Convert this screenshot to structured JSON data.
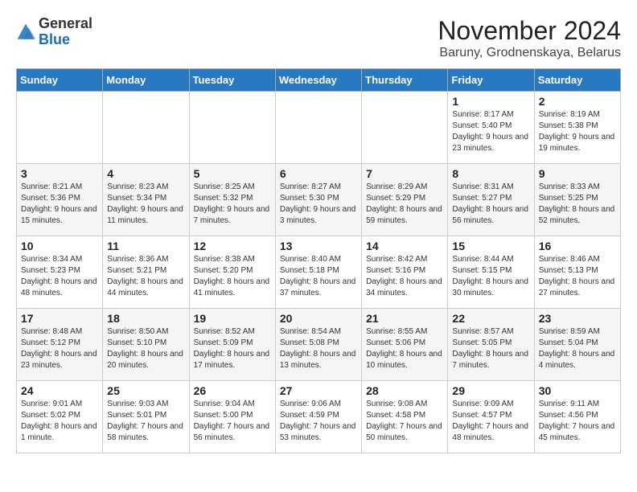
{
  "logo": {
    "general": "General",
    "blue": "Blue"
  },
  "header": {
    "title": "November 2024",
    "subtitle": "Baruny, Grodnenskaya, Belarus"
  },
  "days_of_week": [
    "Sunday",
    "Monday",
    "Tuesday",
    "Wednesday",
    "Thursday",
    "Friday",
    "Saturday"
  ],
  "weeks": [
    [
      {
        "day": "",
        "info": ""
      },
      {
        "day": "",
        "info": ""
      },
      {
        "day": "",
        "info": ""
      },
      {
        "day": "",
        "info": ""
      },
      {
        "day": "",
        "info": ""
      },
      {
        "day": "1",
        "info": "Sunrise: 8:17 AM\nSunset: 5:40 PM\nDaylight: 9 hours and 23 minutes."
      },
      {
        "day": "2",
        "info": "Sunrise: 8:19 AM\nSunset: 5:38 PM\nDaylight: 9 hours and 19 minutes."
      }
    ],
    [
      {
        "day": "3",
        "info": "Sunrise: 8:21 AM\nSunset: 5:36 PM\nDaylight: 9 hours and 15 minutes."
      },
      {
        "day": "4",
        "info": "Sunrise: 8:23 AM\nSunset: 5:34 PM\nDaylight: 9 hours and 11 minutes."
      },
      {
        "day": "5",
        "info": "Sunrise: 8:25 AM\nSunset: 5:32 PM\nDaylight: 9 hours and 7 minutes."
      },
      {
        "day": "6",
        "info": "Sunrise: 8:27 AM\nSunset: 5:30 PM\nDaylight: 9 hours and 3 minutes."
      },
      {
        "day": "7",
        "info": "Sunrise: 8:29 AM\nSunset: 5:29 PM\nDaylight: 8 hours and 59 minutes."
      },
      {
        "day": "8",
        "info": "Sunrise: 8:31 AM\nSunset: 5:27 PM\nDaylight: 8 hours and 56 minutes."
      },
      {
        "day": "9",
        "info": "Sunrise: 8:33 AM\nSunset: 5:25 PM\nDaylight: 8 hours and 52 minutes."
      }
    ],
    [
      {
        "day": "10",
        "info": "Sunrise: 8:34 AM\nSunset: 5:23 PM\nDaylight: 8 hours and 48 minutes."
      },
      {
        "day": "11",
        "info": "Sunrise: 8:36 AM\nSunset: 5:21 PM\nDaylight: 8 hours and 44 minutes."
      },
      {
        "day": "12",
        "info": "Sunrise: 8:38 AM\nSunset: 5:20 PM\nDaylight: 8 hours and 41 minutes."
      },
      {
        "day": "13",
        "info": "Sunrise: 8:40 AM\nSunset: 5:18 PM\nDaylight: 8 hours and 37 minutes."
      },
      {
        "day": "14",
        "info": "Sunrise: 8:42 AM\nSunset: 5:16 PM\nDaylight: 8 hours and 34 minutes."
      },
      {
        "day": "15",
        "info": "Sunrise: 8:44 AM\nSunset: 5:15 PM\nDaylight: 8 hours and 30 minutes."
      },
      {
        "day": "16",
        "info": "Sunrise: 8:46 AM\nSunset: 5:13 PM\nDaylight: 8 hours and 27 minutes."
      }
    ],
    [
      {
        "day": "17",
        "info": "Sunrise: 8:48 AM\nSunset: 5:12 PM\nDaylight: 8 hours and 23 minutes."
      },
      {
        "day": "18",
        "info": "Sunrise: 8:50 AM\nSunset: 5:10 PM\nDaylight: 8 hours and 20 minutes."
      },
      {
        "day": "19",
        "info": "Sunrise: 8:52 AM\nSunset: 5:09 PM\nDaylight: 8 hours and 17 minutes."
      },
      {
        "day": "20",
        "info": "Sunrise: 8:54 AM\nSunset: 5:08 PM\nDaylight: 8 hours and 13 minutes."
      },
      {
        "day": "21",
        "info": "Sunrise: 8:55 AM\nSunset: 5:06 PM\nDaylight: 8 hours and 10 minutes."
      },
      {
        "day": "22",
        "info": "Sunrise: 8:57 AM\nSunset: 5:05 PM\nDaylight: 8 hours and 7 minutes."
      },
      {
        "day": "23",
        "info": "Sunrise: 8:59 AM\nSunset: 5:04 PM\nDaylight: 8 hours and 4 minutes."
      }
    ],
    [
      {
        "day": "24",
        "info": "Sunrise: 9:01 AM\nSunset: 5:02 PM\nDaylight: 8 hours and 1 minute."
      },
      {
        "day": "25",
        "info": "Sunrise: 9:03 AM\nSunset: 5:01 PM\nDaylight: 7 hours and 58 minutes."
      },
      {
        "day": "26",
        "info": "Sunrise: 9:04 AM\nSunset: 5:00 PM\nDaylight: 7 hours and 56 minutes."
      },
      {
        "day": "27",
        "info": "Sunrise: 9:06 AM\nSunset: 4:59 PM\nDaylight: 7 hours and 53 minutes."
      },
      {
        "day": "28",
        "info": "Sunrise: 9:08 AM\nSunset: 4:58 PM\nDaylight: 7 hours and 50 minutes."
      },
      {
        "day": "29",
        "info": "Sunrise: 9:09 AM\nSunset: 4:57 PM\nDaylight: 7 hours and 48 minutes."
      },
      {
        "day": "30",
        "info": "Sunrise: 9:11 AM\nSunset: 4:56 PM\nDaylight: 7 hours and 45 minutes."
      }
    ]
  ]
}
